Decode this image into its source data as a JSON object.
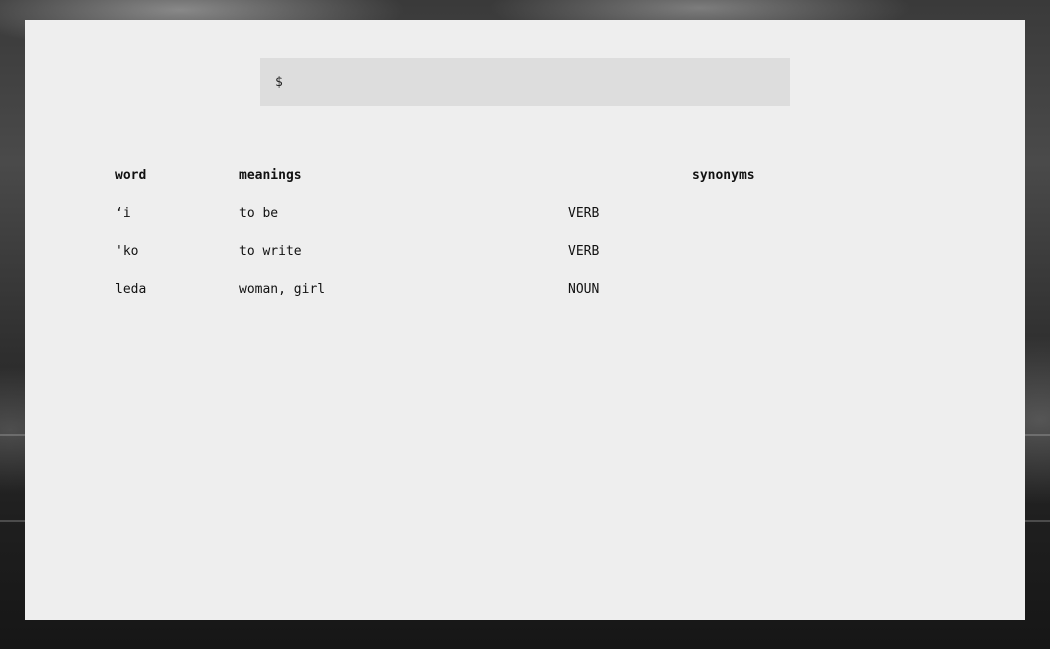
{
  "search": {
    "prompt": "$",
    "value": "",
    "placeholder": ""
  },
  "table": {
    "headers": {
      "word": "word",
      "meanings": "meanings",
      "pos": "",
      "synonyms": "synonyms"
    },
    "rows": [
      {
        "word": "‘i",
        "meanings": "to be",
        "pos": "VERB",
        "synonyms": ""
      },
      {
        "word": "'ko",
        "meanings": "to write",
        "pos": "VERB",
        "synonyms": ""
      },
      {
        "word": "leda",
        "meanings": "woman, girl",
        "pos": "NOUN",
        "synonyms": ""
      }
    ]
  }
}
